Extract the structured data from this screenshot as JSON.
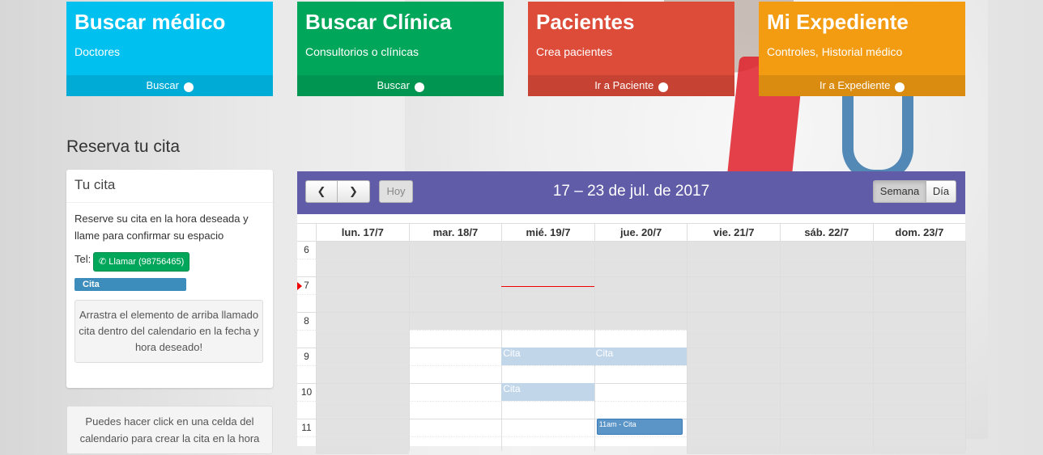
{
  "tiles": [
    {
      "title": "Buscar médico",
      "subtitle": "Doctores",
      "link": "Buscar"
    },
    {
      "title": "Buscar Clínica",
      "subtitle": "Consultorios o clínicas",
      "link": "Buscar"
    },
    {
      "title": "Pacientes",
      "subtitle": "Crea pacientes",
      "link": "Ir a Paciente"
    },
    {
      "title": "Mi Expediente",
      "subtitle": "Controles, Historial médico",
      "link": "Ir a Expediente"
    }
  ],
  "reserve": {
    "title": "Reserva tu cita",
    "box_title": "Tu cita",
    "description": "Reserve su cita en la hora deseada y llame para confirmar su espacio",
    "tel_label": "Tel:",
    "call_button": "Llamar (98756465)",
    "draggable_event": "Cita",
    "drop_hint": "Arrastra el elemento de arriba llamado cita dentro del calendario en la fecha y hora deseado!",
    "click_hint": "Puedes hacer click en una celda del calendario para crear la cita en la hora"
  },
  "calendar": {
    "title": "17 – 23 de jul. de 2017",
    "today_button": "Hoy",
    "view_week": "Semana",
    "view_day": "Día",
    "days": [
      "lun. 17/7",
      "mar. 18/7",
      "mié. 19/7",
      "jue. 20/7",
      "vie. 21/7",
      "sáb. 22/7",
      "dom. 23/7"
    ],
    "hours": [
      "6",
      "7",
      "8",
      "9",
      "10",
      "11"
    ],
    "ghost_event_label": "Cita",
    "event_label": "11am - Cita"
  },
  "colors": {
    "aqua": "#00c0ef",
    "green": "#00a65a",
    "red": "#dd4b39",
    "orange": "#f39c12",
    "header": "#605ca8"
  }
}
